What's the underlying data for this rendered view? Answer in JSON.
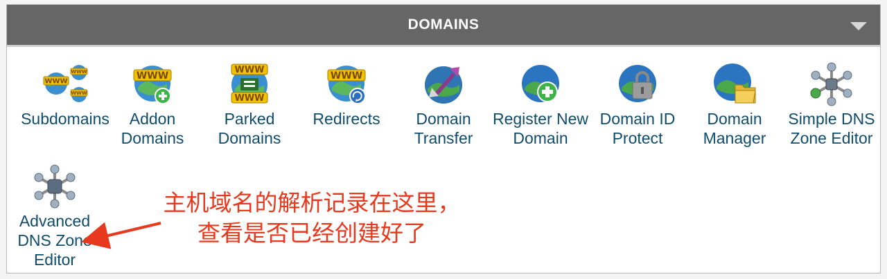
{
  "panel": {
    "title": "DOMAINS"
  },
  "items": [
    {
      "label": "Subdomains",
      "icon": "subdomains-icon"
    },
    {
      "label": "Addon Domains",
      "icon": "addon-domains-icon"
    },
    {
      "label": "Parked Domains",
      "icon": "parked-domains-icon"
    },
    {
      "label": "Redirects",
      "icon": "redirects-icon"
    },
    {
      "label": "Domain Transfer",
      "icon": "domain-transfer-icon"
    },
    {
      "label": "Register New Domain",
      "icon": "register-new-domain-icon"
    },
    {
      "label": "Domain ID Protect",
      "icon": "domain-id-protect-icon"
    },
    {
      "label": "Domain Manager",
      "icon": "domain-manager-icon"
    },
    {
      "label": "Simple DNS Zone Editor",
      "icon": "simple-dns-zone-editor-icon"
    },
    {
      "label": "Advanced DNS Zone Editor",
      "icon": "advanced-dns-zone-editor-icon"
    }
  ],
  "annotation": {
    "line1": "主机域名的解析记录在这里，",
    "line2": "查看是否已经创建好了"
  },
  "colors": {
    "header": "#666666",
    "label": "#0f4c6b",
    "annotation": "#e8381d"
  }
}
